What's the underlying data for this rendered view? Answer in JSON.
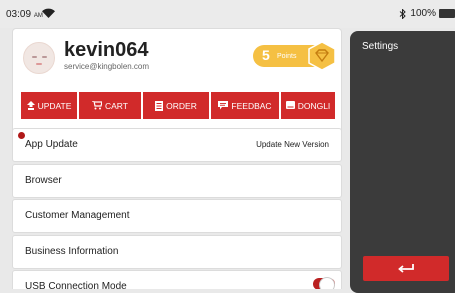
{
  "status_bar": {
    "time": "03:09",
    "ampm": "AM",
    "battery": "100%"
  },
  "profile": {
    "username": "kevin064",
    "email": "service@kingbolen.com",
    "points_value": "5",
    "points_label": "Points"
  },
  "menu": [
    {
      "label": "UPDATE",
      "icon": "upload-icon"
    },
    {
      "label": "CART",
      "icon": "cart-icon"
    },
    {
      "label": "ORDER",
      "icon": "order-icon"
    },
    {
      "label": "FEEDBAC",
      "icon": "feedback-icon"
    },
    {
      "label": "DONGLI",
      "icon": "dongle-icon"
    }
  ],
  "settings_items": [
    {
      "label": "App Update",
      "value": "Update New Version"
    },
    {
      "label": "Browser"
    },
    {
      "label": "Customer Management"
    },
    {
      "label": "Business Information"
    },
    {
      "label": "USB Connection Mode"
    }
  ],
  "sidebar": {
    "title": "Settings",
    "back_icon": "return-arrow-icon"
  },
  "colors": {
    "accent": "#d12a2a",
    "points": "#f5c043",
    "sidebar_bg": "#3b3b3b",
    "notification_dot": "#b01818"
  }
}
